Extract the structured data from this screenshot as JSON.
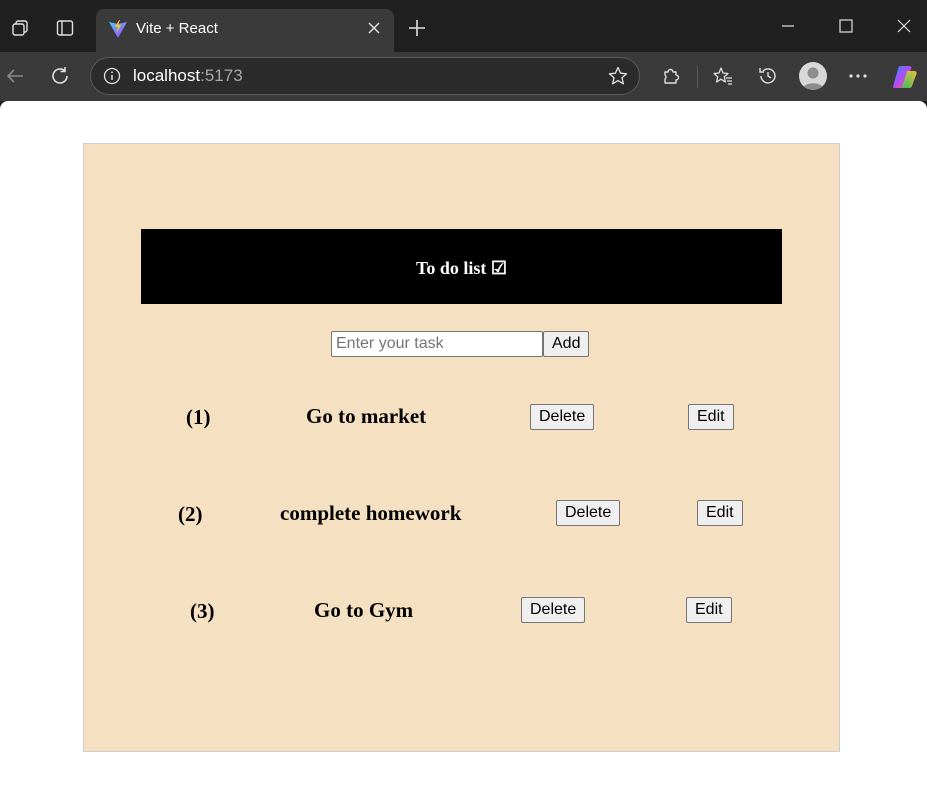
{
  "browser": {
    "tab_title": "Vite + React",
    "url_host": "localhost",
    "url_port": ":5173",
    "icons": [
      "workspaces-icon",
      "tab-actions-icon",
      "vite-logo-icon",
      "close-tab-icon",
      "new-tab-icon",
      "minimize-icon",
      "maximize-icon",
      "close-window-icon",
      "back-icon",
      "refresh-icon",
      "site-info-icon",
      "favorite-star-icon",
      "extensions-icon",
      "favorites-icon",
      "history-icon",
      "profile-avatar",
      "more-icon",
      "copilot-icon"
    ]
  },
  "app": {
    "title": "To do list ☑",
    "input_placeholder": "Enter your task",
    "input_value": "",
    "add_label": "Add",
    "tasks": [
      {
        "index": "(1)",
        "text": "Go to market",
        "delete_label": "Delete",
        "edit_label": "Edit"
      },
      {
        "index": "(2)",
        "text": "complete homework",
        "delete_label": "Delete",
        "edit_label": "Edit"
      },
      {
        "index": "(3)",
        "text": "Go to Gym",
        "delete_label": "Delete",
        "edit_label": "Edit"
      }
    ]
  },
  "colors": {
    "app_background": "#f5e1c1",
    "header_background": "#000000",
    "header_text": "#ffffff",
    "browser_chrome": "#202020",
    "toolbar": "#3a3a3a"
  }
}
